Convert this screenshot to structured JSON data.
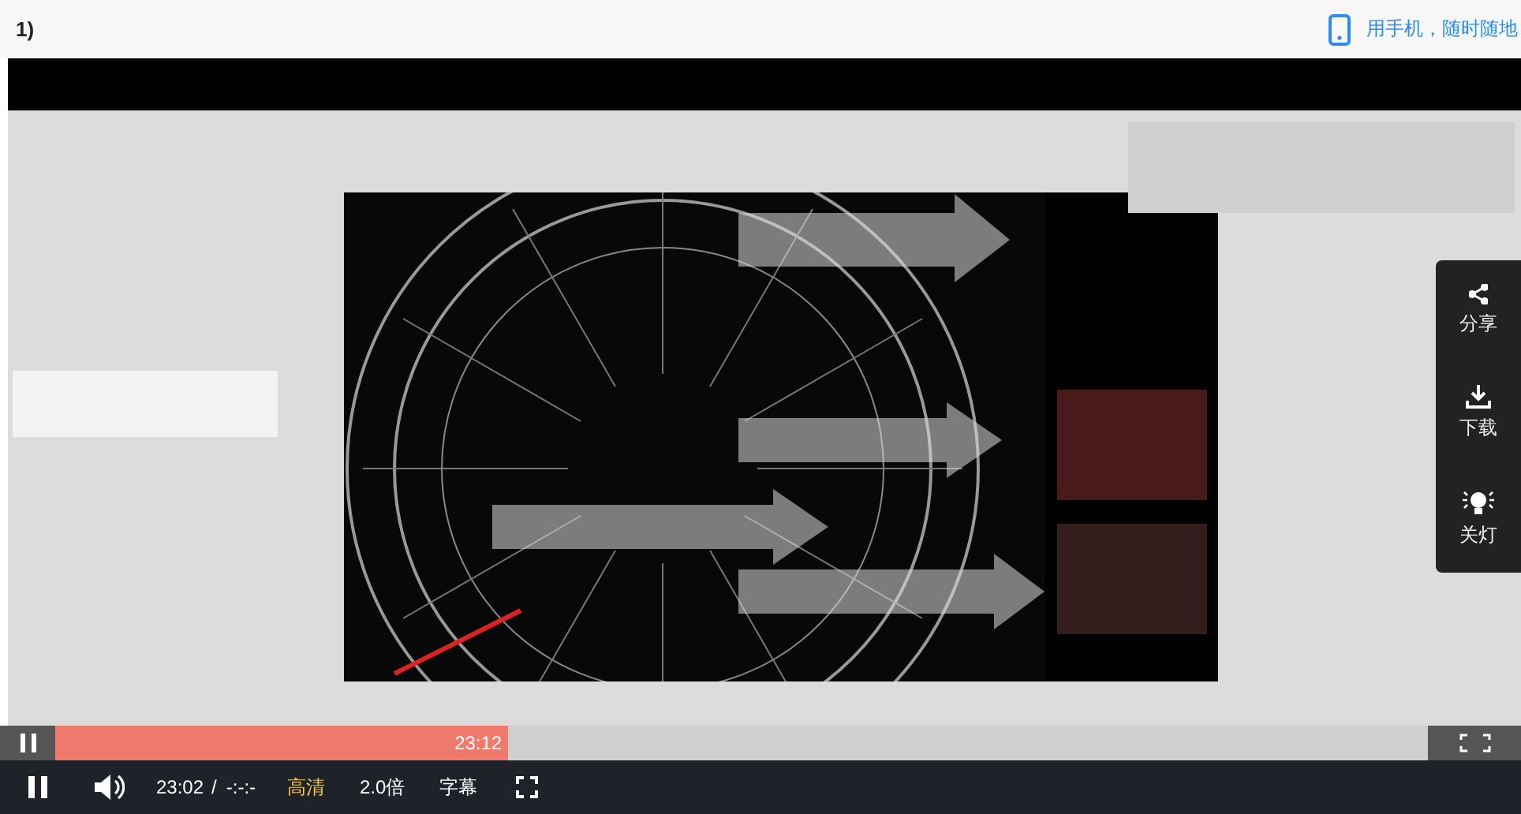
{
  "header": {
    "title": "1)",
    "mobile_link": "用手机，随时随地"
  },
  "side_menu": [
    {
      "kind": "share",
      "label": "分享"
    },
    {
      "kind": "download",
      "label": "下载"
    },
    {
      "kind": "lamp",
      "label": "关灯"
    }
  ],
  "seek_bar": {
    "level": 0.33,
    "time": "23:12"
  },
  "controls": {
    "playing": true,
    "current_time": "23:02",
    "separator": "/",
    "duration": "-:-:-",
    "quality": "高清",
    "speed": "2.0倍",
    "subtitles": "字幕"
  }
}
